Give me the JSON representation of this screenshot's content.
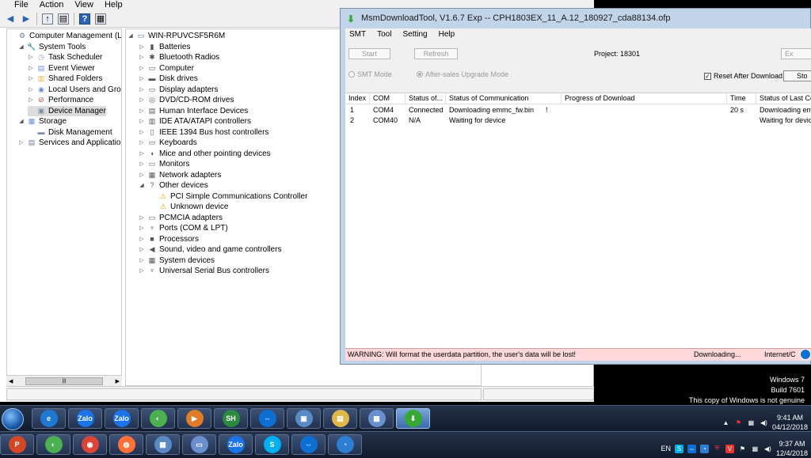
{
  "cm": {
    "menu": [
      "File",
      "Action",
      "View",
      "Help"
    ],
    "tree": [
      {
        "label": "Computer Management (Local",
        "level": 0,
        "arrow": "",
        "icon": "computer-management-icon",
        "glyph": "⚙",
        "color": "#6a7fa0"
      },
      {
        "label": "System Tools",
        "level": 1,
        "arrow": "◢",
        "icon": "tools-icon",
        "glyph": "🔧",
        "color": "#c7a24a"
      },
      {
        "label": "Task Scheduler",
        "level": 2,
        "arrow": "▷",
        "icon": "clock-icon",
        "glyph": "◷",
        "color": "#8aa0c0"
      },
      {
        "label": "Event Viewer",
        "level": 2,
        "arrow": "▷",
        "icon": "event-viewer-icon",
        "glyph": "▤",
        "color": "#6a8fcf"
      },
      {
        "label": "Shared Folders",
        "level": 2,
        "arrow": "▷",
        "icon": "shared-folder-icon",
        "glyph": "▥",
        "color": "#d9b64a"
      },
      {
        "label": "Local Users and Groups",
        "level": 2,
        "arrow": "▷",
        "icon": "users-icon",
        "glyph": "◉",
        "color": "#6b8bc9"
      },
      {
        "label": "Performance",
        "level": 2,
        "arrow": "▷",
        "icon": "performance-icon",
        "glyph": "⊘",
        "color": "#c84b3a"
      },
      {
        "label": "Device Manager",
        "level": 2,
        "arrow": "",
        "icon": "device-manager-icon",
        "glyph": "▣",
        "color": "#7a8fa8"
      },
      {
        "label": "Storage",
        "level": 1,
        "arrow": "◢",
        "icon": "storage-icon",
        "glyph": "▦",
        "color": "#6a8fcf"
      },
      {
        "label": "Disk Management",
        "level": 2,
        "arrow": "",
        "icon": "disk-management-icon",
        "glyph": "▬",
        "color": "#7a8fa8"
      },
      {
        "label": "Services and Applications",
        "level": 1,
        "arrow": "▷",
        "icon": "services-icon",
        "glyph": "▤",
        "color": "#6a7fa0"
      }
    ],
    "device_root": "WIN-RPUVCSF5R6M",
    "devices": [
      {
        "label": "Batteries",
        "level": 1,
        "arrow": "▷",
        "icon": "battery-icon",
        "glyph": "▮"
      },
      {
        "label": "Bluetooth Radios",
        "level": 1,
        "arrow": "▷",
        "icon": "bluetooth-icon",
        "glyph": "✱"
      },
      {
        "label": "Computer",
        "level": 1,
        "arrow": "▷",
        "icon": "computer-icon",
        "glyph": "▭"
      },
      {
        "label": "Disk drives",
        "level": 1,
        "arrow": "▷",
        "icon": "disk-drive-icon",
        "glyph": "▬"
      },
      {
        "label": "Display adapters",
        "level": 1,
        "arrow": "▷",
        "icon": "display-adapter-icon",
        "glyph": "▭"
      },
      {
        "label": "DVD/CD-ROM drives",
        "level": 1,
        "arrow": "▷",
        "icon": "dvd-icon",
        "glyph": "◎"
      },
      {
        "label": "Human Interface Devices",
        "level": 1,
        "arrow": "▷",
        "icon": "hid-icon",
        "glyph": "▤"
      },
      {
        "label": "IDE ATA/ATAPI controllers",
        "level": 1,
        "arrow": "▷",
        "icon": "ide-controller-icon",
        "glyph": "▥"
      },
      {
        "label": "IEEE 1394 Bus host controllers",
        "level": 1,
        "arrow": "▷",
        "icon": "ieee1394-icon",
        "glyph": "▯"
      },
      {
        "label": "Keyboards",
        "level": 1,
        "arrow": "▷",
        "icon": "keyboard-icon",
        "glyph": "▭"
      },
      {
        "label": "Mice and other pointing devices",
        "level": 1,
        "arrow": "▷",
        "icon": "mouse-icon",
        "glyph": "◖"
      },
      {
        "label": "Monitors",
        "level": 1,
        "arrow": "▷",
        "icon": "monitor-icon",
        "glyph": "▭"
      },
      {
        "label": "Network adapters",
        "level": 1,
        "arrow": "▷",
        "icon": "network-adapter-icon",
        "glyph": "▦"
      },
      {
        "label": "Other devices",
        "level": 1,
        "arrow": "◢",
        "icon": "other-devices-icon",
        "glyph": "?"
      },
      {
        "label": "PCI Simple Communications Controller",
        "level": 2,
        "arrow": "",
        "icon": "warning-device-icon",
        "glyph": "⚠"
      },
      {
        "label": "Unknown device",
        "level": 2,
        "arrow": "",
        "icon": "warning-device-icon",
        "glyph": "⚠"
      },
      {
        "label": "PCMCIA adapters",
        "level": 1,
        "arrow": "▷",
        "icon": "pcmcia-icon",
        "glyph": "▭"
      },
      {
        "label": "Ports (COM & LPT)",
        "level": 1,
        "arrow": "▷",
        "icon": "port-icon",
        "glyph": "♆"
      },
      {
        "label": "Processors",
        "level": 1,
        "arrow": "▷",
        "icon": "processor-icon",
        "glyph": "■"
      },
      {
        "label": "Sound, video and game controllers",
        "level": 1,
        "arrow": "▷",
        "icon": "sound-icon",
        "glyph": "◀"
      },
      {
        "label": "System devices",
        "level": 1,
        "arrow": "▷",
        "icon": "system-device-icon",
        "glyph": "▦"
      },
      {
        "label": "Universal Serial Bus controllers",
        "level": 1,
        "arrow": "▷",
        "icon": "usb-icon",
        "glyph": "♆"
      }
    ]
  },
  "msm": {
    "title": "MsmDownloadTool, V1.6.7 Exp -- CPH1803EX_11_A.12_180927_cda88134.ofp",
    "menu": [
      "SMT",
      "Tool",
      "Setting",
      "Help"
    ],
    "start_label": "Start",
    "refresh_label": "Refresh",
    "project_label": "Project: 18301",
    "exit_label": "Ex",
    "smt_mode_label": "SMT Mode",
    "aftersales_label": "After-sales Upgrade Mode",
    "reset_label": "Reset After Download",
    "stop_label": "Sto",
    "columns": [
      "Index",
      "COM",
      "Status of...",
      "Status of Communication",
      "Progress of Download",
      "Time",
      "Status of Last Co"
    ],
    "rows": [
      [
        "1",
        "COM4",
        "Connected",
        "Downloading emmc_fw.bin",
        "",
        "20 s",
        "Downloading emm"
      ],
      [
        "2",
        "COM40",
        "N/A",
        "Waiting for device",
        "",
        "",
        "Waiting for devic"
      ]
    ],
    "marker": "!",
    "warning": "WARNING: Will format the userdata partition, the user's data will be lost!",
    "downloading": "Downloading...",
    "internet": "Internet/C"
  },
  "watermark": {
    "line1": "Windows 7",
    "line2": "Build 7601",
    "line3": "This copy of Windows is not genuine"
  },
  "taskbar1": {
    "apps": [
      {
        "name": "ie-icon",
        "glyph": "e",
        "color": "#1f78d1"
      },
      {
        "name": "zalo-icon",
        "glyph": "Zalo",
        "color": "#1a73e8"
      },
      {
        "name": "zalo-notify-icon",
        "glyph": "Zalo",
        "color": "#1a73e8"
      },
      {
        "name": "coccoc-icon",
        "glyph": "◐",
        "color": "#4caf50"
      },
      {
        "name": "media-player-icon",
        "glyph": "▶",
        "color": "#e07b2a"
      },
      {
        "name": "sh-icon",
        "glyph": "SH",
        "color": "#2b8a3e"
      },
      {
        "name": "teamviewer-icon",
        "glyph": "⇔",
        "color": "#0e6fd3"
      },
      {
        "name": "remote-desktop-icon",
        "glyph": "▣",
        "color": "#5a8ac6"
      },
      {
        "name": "folder-icon",
        "glyph": "▤",
        "color": "#e0b84a"
      },
      {
        "name": "computer-management-icon",
        "glyph": "▦",
        "color": "#6a8fcf"
      },
      {
        "name": "download-tool-icon",
        "glyph": "⬇",
        "color": "#37a832"
      }
    ],
    "time": "9:41 AM",
    "date": "04/12/2018"
  },
  "taskbar2": {
    "apps": [
      {
        "name": "powerpoint-icon",
        "glyph": "P",
        "color": "#d24726"
      },
      {
        "name": "coccoc-icon",
        "glyph": "◐",
        "color": "#4caf50"
      },
      {
        "name": "chrome-icon",
        "glyph": "◉",
        "color": "#db4437"
      },
      {
        "name": "firefox-icon",
        "glyph": "◍",
        "color": "#ff7139"
      },
      {
        "name": "network-icon",
        "glyph": "▦",
        "color": "#5a8ac6"
      },
      {
        "name": "computer-icon",
        "glyph": "▭",
        "color": "#6a8fcf"
      },
      {
        "name": "zalo-icon",
        "glyph": "Zalo",
        "color": "#1a73e8"
      },
      {
        "name": "skype-icon",
        "glyph": "S",
        "color": "#00aff0"
      },
      {
        "name": "teamviewer-icon",
        "glyph": "⇔",
        "color": "#0e6fd3"
      },
      {
        "name": "remote-icon",
        "glyph": "◔",
        "color": "#2d7dd2"
      }
    ],
    "lang": "EN",
    "time": "9:37 AM",
    "date": "12/4/2018"
  },
  "colors": {
    "accent": "#3a6aaa",
    "warning_bar": "#ffd9d9",
    "title_bar": "#c2d4ea"
  }
}
